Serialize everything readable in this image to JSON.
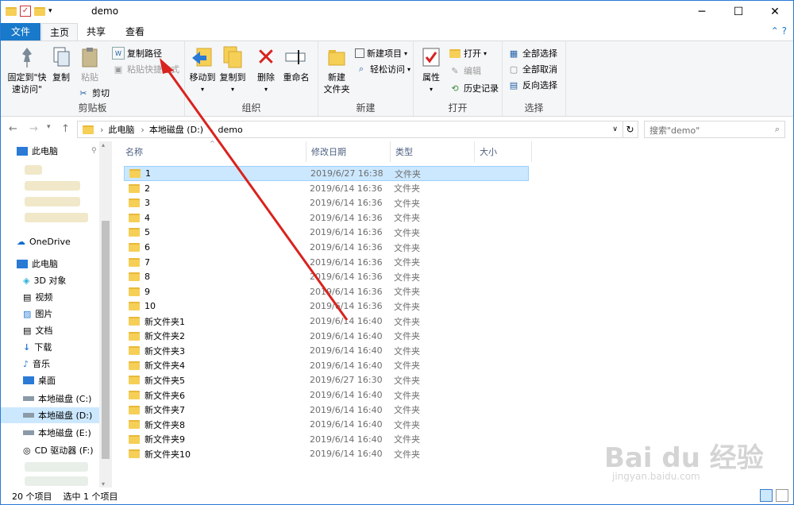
{
  "window": {
    "title": "demo"
  },
  "tabs": {
    "file": "文件",
    "home": "主页",
    "share": "共享",
    "view": "查看"
  },
  "ribbon": {
    "clipboard": {
      "pin": "固定到\"快\n速访问\"",
      "copy": "复制",
      "paste": "粘贴",
      "copy_path": "复制路径",
      "paste_shortcut": "粘贴快捷方式",
      "cut": "剪切",
      "label": "剪贴板"
    },
    "organize": {
      "move_to": "移动到",
      "copy_to": "复制到",
      "delete": "删除",
      "rename": "重命名",
      "label": "组织"
    },
    "new": {
      "new_folder": "新建\n文件夹",
      "new_item": "新建项目",
      "easy_access": "轻松访问",
      "label": "新建"
    },
    "open": {
      "properties": "属性",
      "open": "打开",
      "edit": "编辑",
      "history": "历史记录",
      "label": "打开"
    },
    "select": {
      "select_all": "全部选择",
      "select_none": "全部取消",
      "invert": "反向选择",
      "label": "选择"
    }
  },
  "address": {
    "this_pc": "此电脑",
    "drive": "本地磁盘 (D:)",
    "folder": "demo",
    "search_placeholder": "搜索\"demo\""
  },
  "sidebar": {
    "quick": "此电脑",
    "onedrive": "OneDrive",
    "this_pc": "此电脑",
    "items": [
      "3D 对象",
      "视频",
      "图片",
      "文档",
      "下载",
      "音乐",
      "桌面",
      "本地磁盘 (C:)",
      "本地磁盘 (D:)",
      "本地磁盘 (E:)",
      "CD 驱动器 (F:)"
    ]
  },
  "columns": {
    "name": "名称",
    "date": "修改日期",
    "type": "类型",
    "size": "大小"
  },
  "files": [
    {
      "name": "1",
      "date": "2019/6/27 16:38",
      "type": "文件夹"
    },
    {
      "name": "2",
      "date": "2019/6/14 16:36",
      "type": "文件夹"
    },
    {
      "name": "3",
      "date": "2019/6/14 16:36",
      "type": "文件夹"
    },
    {
      "name": "4",
      "date": "2019/6/14 16:36",
      "type": "文件夹"
    },
    {
      "name": "5",
      "date": "2019/6/14 16:36",
      "type": "文件夹"
    },
    {
      "name": "6",
      "date": "2019/6/14 16:36",
      "type": "文件夹"
    },
    {
      "name": "7",
      "date": "2019/6/14 16:36",
      "type": "文件夹"
    },
    {
      "name": "8",
      "date": "2019/6/14 16:36",
      "type": "文件夹"
    },
    {
      "name": "9",
      "date": "2019/6/14 16:36",
      "type": "文件夹"
    },
    {
      "name": "10",
      "date": "2019/6/14 16:36",
      "type": "文件夹"
    },
    {
      "name": "新文件夹1",
      "date": "2019/6/14 16:40",
      "type": "文件夹"
    },
    {
      "name": "新文件夹2",
      "date": "2019/6/14 16:40",
      "type": "文件夹"
    },
    {
      "name": "新文件夹3",
      "date": "2019/6/14 16:40",
      "type": "文件夹"
    },
    {
      "name": "新文件夹4",
      "date": "2019/6/14 16:40",
      "type": "文件夹"
    },
    {
      "name": "新文件夹5",
      "date": "2019/6/27 16:30",
      "type": "文件夹"
    },
    {
      "name": "新文件夹6",
      "date": "2019/6/14 16:40",
      "type": "文件夹"
    },
    {
      "name": "新文件夹7",
      "date": "2019/6/14 16:40",
      "type": "文件夹"
    },
    {
      "name": "新文件夹8",
      "date": "2019/6/14 16:40",
      "type": "文件夹"
    },
    {
      "name": "新文件夹9",
      "date": "2019/6/14 16:40",
      "type": "文件夹"
    },
    {
      "name": "新文件夹10",
      "date": "2019/6/14 16:40",
      "type": "文件夹"
    }
  ],
  "status": {
    "count": "20 个项目",
    "selected": "选中 1 个项目"
  },
  "watermark": {
    "brand": "Bai du 经验",
    "url": "jingyan.baidu.com"
  }
}
